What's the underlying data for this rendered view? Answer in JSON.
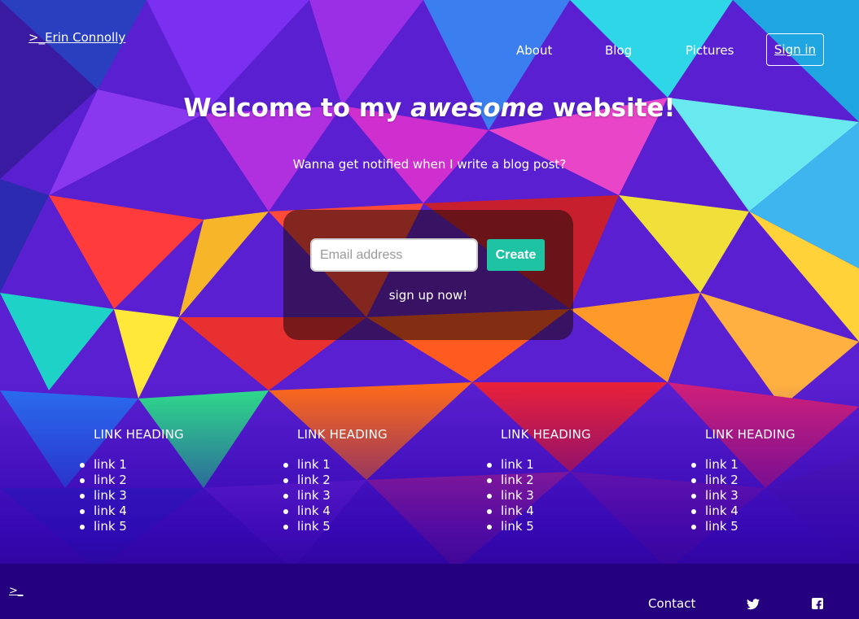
{
  "header": {
    "brand": ">_Erin Connolly",
    "nav": [
      "About",
      "Blog",
      "Pictures"
    ],
    "sign_in": "Sign in"
  },
  "hero": {
    "title_before": "Welcome to my ",
    "title_emphasis": "awesome",
    "title_after": " website!",
    "subtitle": "Wanna get notified when I write a blog post?"
  },
  "signup": {
    "email_placeholder": "Email address",
    "email_value": "",
    "create_label": "Create",
    "caption": "sign up now!"
  },
  "link_columns": [
    {
      "heading": "LINK HEADING",
      "links": [
        "link 1",
        "link 2",
        "link 3",
        "link 4",
        "link 5"
      ]
    },
    {
      "heading": "LINK HEADING",
      "links": [
        "link 1",
        "link 2",
        "link 3",
        "link 4",
        "link 5"
      ]
    },
    {
      "heading": "LINK HEADING",
      "links": [
        "link 1",
        "link 2",
        "link 3",
        "link 4",
        "link 5"
      ]
    },
    {
      "heading": "LINK HEADING",
      "links": [
        "link 1",
        "link 2",
        "link 3",
        "link 4",
        "link 5"
      ]
    }
  ],
  "footer": {
    "prompt": ">_",
    "contact": "Contact",
    "icons": [
      "twitter-icon",
      "facebook-icon"
    ]
  }
}
